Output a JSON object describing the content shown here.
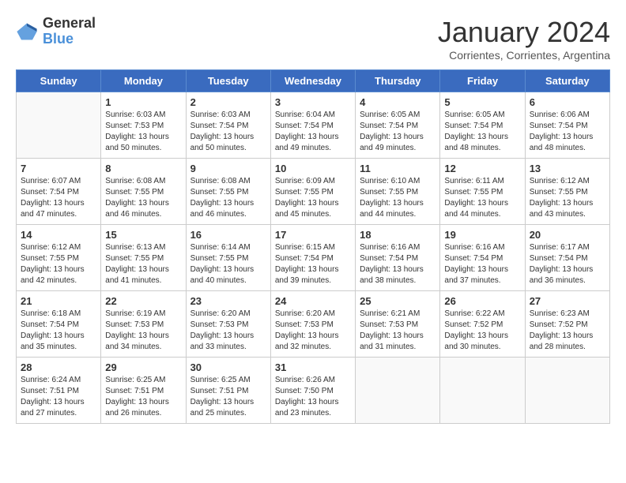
{
  "header": {
    "logo_line1": "General",
    "logo_line2": "Blue",
    "month": "January 2024",
    "location": "Corrientes, Corrientes, Argentina"
  },
  "days_of_week": [
    "Sunday",
    "Monday",
    "Tuesday",
    "Wednesday",
    "Thursday",
    "Friday",
    "Saturday"
  ],
  "weeks": [
    [
      {
        "day": "",
        "sunrise": "",
        "sunset": "",
        "daylight": ""
      },
      {
        "day": "1",
        "sunrise": "Sunrise: 6:03 AM",
        "sunset": "Sunset: 7:53 PM",
        "daylight": "Daylight: 13 hours and 50 minutes."
      },
      {
        "day": "2",
        "sunrise": "Sunrise: 6:03 AM",
        "sunset": "Sunset: 7:54 PM",
        "daylight": "Daylight: 13 hours and 50 minutes."
      },
      {
        "day": "3",
        "sunrise": "Sunrise: 6:04 AM",
        "sunset": "Sunset: 7:54 PM",
        "daylight": "Daylight: 13 hours and 49 minutes."
      },
      {
        "day": "4",
        "sunrise": "Sunrise: 6:05 AM",
        "sunset": "Sunset: 7:54 PM",
        "daylight": "Daylight: 13 hours and 49 minutes."
      },
      {
        "day": "5",
        "sunrise": "Sunrise: 6:05 AM",
        "sunset": "Sunset: 7:54 PM",
        "daylight": "Daylight: 13 hours and 48 minutes."
      },
      {
        "day": "6",
        "sunrise": "Sunrise: 6:06 AM",
        "sunset": "Sunset: 7:54 PM",
        "daylight": "Daylight: 13 hours and 48 minutes."
      }
    ],
    [
      {
        "day": "7",
        "sunrise": "Sunrise: 6:07 AM",
        "sunset": "Sunset: 7:54 PM",
        "daylight": "Daylight: 13 hours and 47 minutes."
      },
      {
        "day": "8",
        "sunrise": "Sunrise: 6:08 AM",
        "sunset": "Sunset: 7:55 PM",
        "daylight": "Daylight: 13 hours and 46 minutes."
      },
      {
        "day": "9",
        "sunrise": "Sunrise: 6:08 AM",
        "sunset": "Sunset: 7:55 PM",
        "daylight": "Daylight: 13 hours and 46 minutes."
      },
      {
        "day": "10",
        "sunrise": "Sunrise: 6:09 AM",
        "sunset": "Sunset: 7:55 PM",
        "daylight": "Daylight: 13 hours and 45 minutes."
      },
      {
        "day": "11",
        "sunrise": "Sunrise: 6:10 AM",
        "sunset": "Sunset: 7:55 PM",
        "daylight": "Daylight: 13 hours and 44 minutes."
      },
      {
        "day": "12",
        "sunrise": "Sunrise: 6:11 AM",
        "sunset": "Sunset: 7:55 PM",
        "daylight": "Daylight: 13 hours and 44 minutes."
      },
      {
        "day": "13",
        "sunrise": "Sunrise: 6:12 AM",
        "sunset": "Sunset: 7:55 PM",
        "daylight": "Daylight: 13 hours and 43 minutes."
      }
    ],
    [
      {
        "day": "14",
        "sunrise": "Sunrise: 6:12 AM",
        "sunset": "Sunset: 7:55 PM",
        "daylight": "Daylight: 13 hours and 42 minutes."
      },
      {
        "day": "15",
        "sunrise": "Sunrise: 6:13 AM",
        "sunset": "Sunset: 7:55 PM",
        "daylight": "Daylight: 13 hours and 41 minutes."
      },
      {
        "day": "16",
        "sunrise": "Sunrise: 6:14 AM",
        "sunset": "Sunset: 7:55 PM",
        "daylight": "Daylight: 13 hours and 40 minutes."
      },
      {
        "day": "17",
        "sunrise": "Sunrise: 6:15 AM",
        "sunset": "Sunset: 7:54 PM",
        "daylight": "Daylight: 13 hours and 39 minutes."
      },
      {
        "day": "18",
        "sunrise": "Sunrise: 6:16 AM",
        "sunset": "Sunset: 7:54 PM",
        "daylight": "Daylight: 13 hours and 38 minutes."
      },
      {
        "day": "19",
        "sunrise": "Sunrise: 6:16 AM",
        "sunset": "Sunset: 7:54 PM",
        "daylight": "Daylight: 13 hours and 37 minutes."
      },
      {
        "day": "20",
        "sunrise": "Sunrise: 6:17 AM",
        "sunset": "Sunset: 7:54 PM",
        "daylight": "Daylight: 13 hours and 36 minutes."
      }
    ],
    [
      {
        "day": "21",
        "sunrise": "Sunrise: 6:18 AM",
        "sunset": "Sunset: 7:54 PM",
        "daylight": "Daylight: 13 hours and 35 minutes."
      },
      {
        "day": "22",
        "sunrise": "Sunrise: 6:19 AM",
        "sunset": "Sunset: 7:53 PM",
        "daylight": "Daylight: 13 hours and 34 minutes."
      },
      {
        "day": "23",
        "sunrise": "Sunrise: 6:20 AM",
        "sunset": "Sunset: 7:53 PM",
        "daylight": "Daylight: 13 hours and 33 minutes."
      },
      {
        "day": "24",
        "sunrise": "Sunrise: 6:20 AM",
        "sunset": "Sunset: 7:53 PM",
        "daylight": "Daylight: 13 hours and 32 minutes."
      },
      {
        "day": "25",
        "sunrise": "Sunrise: 6:21 AM",
        "sunset": "Sunset: 7:53 PM",
        "daylight": "Daylight: 13 hours and 31 minutes."
      },
      {
        "day": "26",
        "sunrise": "Sunrise: 6:22 AM",
        "sunset": "Sunset: 7:52 PM",
        "daylight": "Daylight: 13 hours and 30 minutes."
      },
      {
        "day": "27",
        "sunrise": "Sunrise: 6:23 AM",
        "sunset": "Sunset: 7:52 PM",
        "daylight": "Daylight: 13 hours and 28 minutes."
      }
    ],
    [
      {
        "day": "28",
        "sunrise": "Sunrise: 6:24 AM",
        "sunset": "Sunset: 7:51 PM",
        "daylight": "Daylight: 13 hours and 27 minutes."
      },
      {
        "day": "29",
        "sunrise": "Sunrise: 6:25 AM",
        "sunset": "Sunset: 7:51 PM",
        "daylight": "Daylight: 13 hours and 26 minutes."
      },
      {
        "day": "30",
        "sunrise": "Sunrise: 6:25 AM",
        "sunset": "Sunset: 7:51 PM",
        "daylight": "Daylight: 13 hours and 25 minutes."
      },
      {
        "day": "31",
        "sunrise": "Sunrise: 6:26 AM",
        "sunset": "Sunset: 7:50 PM",
        "daylight": "Daylight: 13 hours and 23 minutes."
      },
      {
        "day": "",
        "sunrise": "",
        "sunset": "",
        "daylight": ""
      },
      {
        "day": "",
        "sunrise": "",
        "sunset": "",
        "daylight": ""
      },
      {
        "day": "",
        "sunrise": "",
        "sunset": "",
        "daylight": ""
      }
    ]
  ]
}
